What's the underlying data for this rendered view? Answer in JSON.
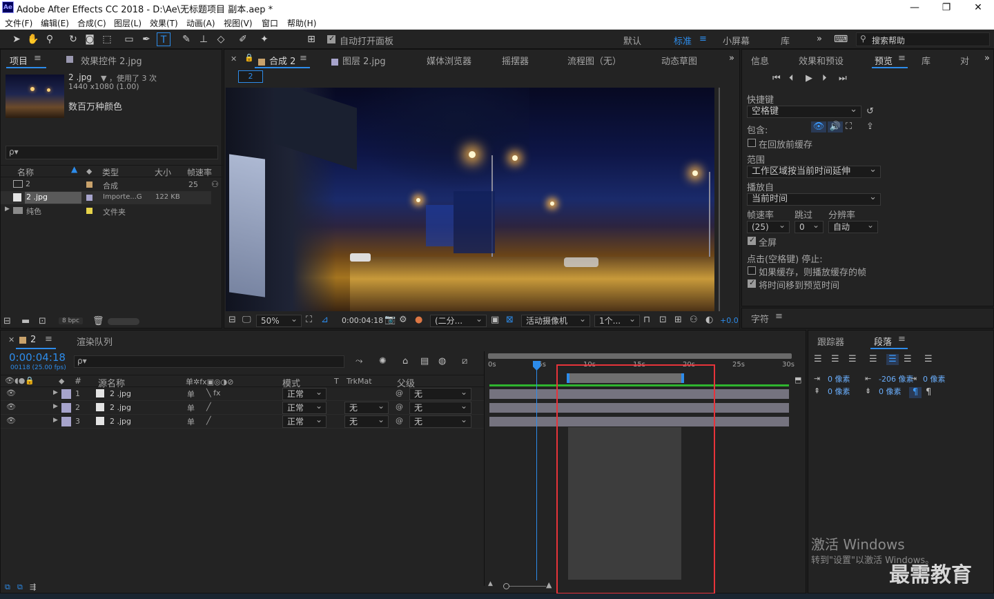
{
  "titlebar": {
    "app_icon": "Ae",
    "title": "Adobe After Effects CC 2018 - D:\\Ae\\无标题项目 副本.aep *",
    "minimize": "—",
    "restore": "❐",
    "close": "✕"
  },
  "menu": [
    "文件(F)",
    "编辑(E)",
    "合成(C)",
    "图层(L)",
    "效果(T)",
    "动画(A)",
    "视图(V)",
    "窗口",
    "帮助(H)"
  ],
  "toolbar": {
    "auto_open_label": "自动打开面板",
    "workspaces": [
      "默认",
      "标准",
      "小屏幕",
      "库"
    ],
    "active_workspace": "标准",
    "search_placeholder": "搜索帮助",
    "more": "»"
  },
  "project": {
    "tab_project": "项目",
    "tab_effects": "效果控件 2.jpg",
    "asset_name": "2 .jpg",
    "asset_used": "▼ ，使用了 3 次",
    "asset_dims": "1440 x1080 (1.00)",
    "asset_colors": "数百万种颜色",
    "search_placeholder": "ρ▾",
    "columns": [
      "名称",
      "类型",
      "大小",
      "帧速率"
    ],
    "items": [
      {
        "name": "2",
        "type": "合成",
        "size": "",
        "fps": "25",
        "color": "#c9a26b"
      },
      {
        "name": "2 .jpg",
        "type": "Importe...G",
        "size": "122 KB",
        "fps": "",
        "color": "#a7a4cc"
      },
      {
        "name": "纯色",
        "type": "文件夹",
        "size": "",
        "fps": "",
        "color": "#e6d34a"
      }
    ],
    "bpc": "8 bpc"
  },
  "viewer": {
    "tab_comp": "合成 2",
    "tab_layer": "图层 2.jpg",
    "tab_media": "媒体浏览器",
    "tab_wiggler": "摇摆器",
    "tab_flow": "流程图（无）",
    "tab_motion": "动态草图",
    "comp_chip": "2",
    "zoom": "50%",
    "timecode": "0:00:04:18",
    "resolution": "(二分...",
    "camera": "活动摄像机",
    "views": "1个...",
    "exposure": "+0.0"
  },
  "preview": {
    "tab_info": "信息",
    "tab_effects": "效果和预设",
    "tab_preview": "预览",
    "tab_lib": "库",
    "tab_more": "对",
    "more": "»",
    "shortcut_label": "快捷键",
    "shortcut_value": "空格键",
    "include_label": "包含:",
    "cache_label": "在回放前缓存",
    "range_label": "范围",
    "range_value": "工作区域按当前时间延伸",
    "play_from_label": "播放自",
    "play_from_value": "当前时间",
    "fps_label": "帧速率",
    "skip_label": "跳过",
    "res_label": "分辨率",
    "fps_value": "(25)",
    "skip_value": "0",
    "res_value": "自动",
    "fullscreen_label": "全屏",
    "stop_label": "点击(空格键) 停止:",
    "if_cache_label": "如果缓存，则播放缓存的帧",
    "move_time_label": "将时间移到预览时间",
    "char_tab": "字符"
  },
  "timeline": {
    "tab_comp": "2",
    "tab_render": "渲染队列",
    "timecode": "0:00:04:18",
    "frames": "00118 (25.00 fps)",
    "search_placeholder": "ρ▾",
    "cols": {
      "num": "#",
      "source": "源名称",
      "mode": "模式",
      "t": "T",
      "trkmat": "TrkMat",
      "parent": "父级"
    },
    "ruler": [
      "0s",
      "05s",
      "10s",
      "15s",
      "20s",
      "25s",
      "30s"
    ],
    "layers": [
      {
        "num": "1",
        "name": "2 .jpg",
        "mode": "正常",
        "trkmat": "",
        "parent": "无"
      },
      {
        "num": "2",
        "name": "2 .jpg",
        "mode": "正常",
        "trkmat": "无",
        "parent": "无"
      },
      {
        "num": "3",
        "name": "2 .jpg",
        "mode": "正常",
        "trkmat": "无",
        "parent": "无"
      }
    ]
  },
  "paragraph": {
    "tab_tracker": "跟踪器",
    "tab_para": "段落",
    "indent_left": "0 像素",
    "indent_first": "-206 像素",
    "indent_right": "0 像素",
    "space_before": "0 像素",
    "space_after": "0 像素"
  },
  "watermark": {
    "activate": "激活 Windows",
    "goto": "转到\"设置\"以激活 Windows。",
    "brand": "最需教育"
  }
}
